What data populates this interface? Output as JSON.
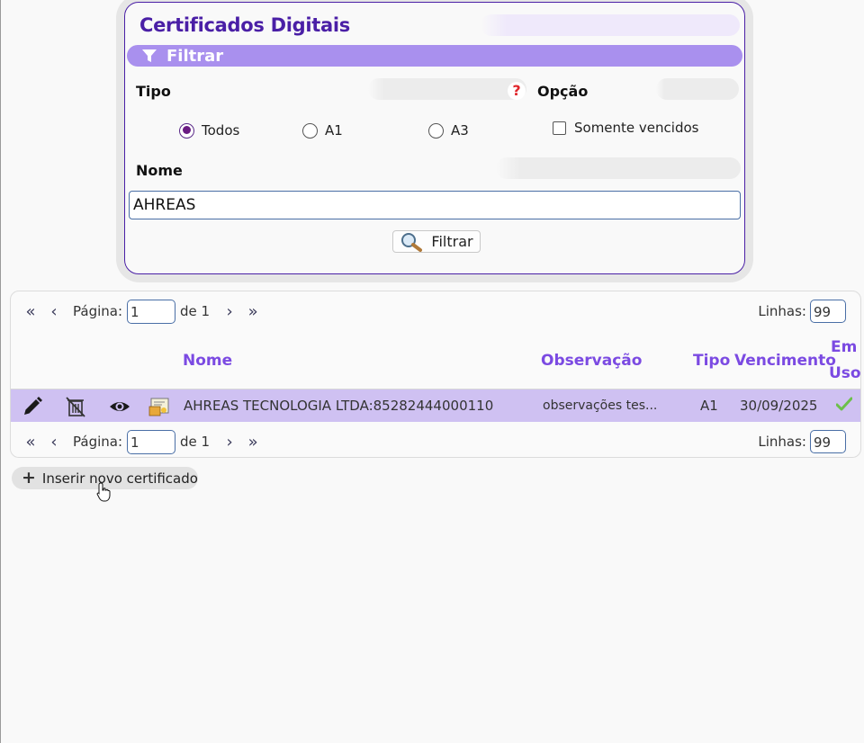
{
  "filter": {
    "title": "Certificados Digitais",
    "header_label": "Filtrar",
    "tipo_label": "Tipo",
    "tipo_help": "?",
    "opcao_label": "Opção",
    "tipo_options": [
      {
        "label": "Todos",
        "selected": true
      },
      {
        "label": "A1",
        "selected": false
      },
      {
        "label": "A3",
        "selected": false
      }
    ],
    "somente_vencidos_label": "Somente vencidos",
    "somente_vencidos_checked": false,
    "nome_label": "Nome",
    "nome_value": "AHREAS",
    "button_label": "Filtrar"
  },
  "pager_top": {
    "pagina_label": "Página:",
    "page_value": "1",
    "de_label": "de 1",
    "linhas_label": "Linhas:",
    "rows_value": "99"
  },
  "pager_bottom": {
    "pagina_label": "Página:",
    "page_value": "1",
    "de_label": "de 1",
    "linhas_label": "Linhas:",
    "rows_value": "99"
  },
  "table": {
    "columns": {
      "nome": "Nome",
      "observacao": "Observação",
      "tipo": "Tipo",
      "vencimento": "Vencimento",
      "em_uso_1": "Em",
      "em_uso_2": "Uso"
    },
    "rows": [
      {
        "nome": "AHREAS TECNOLOGIA LTDA:85282444000110",
        "observacao": "observações tes...",
        "tipo": "A1",
        "vencimento": "30/09/2025",
        "em_uso": true,
        "actions": [
          "edit-icon",
          "delete-icon",
          "view-icon",
          "certificate-icon"
        ]
      }
    ]
  },
  "insert_button": {
    "icon": "plus",
    "label": "Inserir novo certificado"
  },
  "colors": {
    "accent": "#4a1fa6",
    "header_bar": "#a990ee",
    "column_header": "#7b4ae2",
    "selected_row": "#cfc1f2"
  }
}
